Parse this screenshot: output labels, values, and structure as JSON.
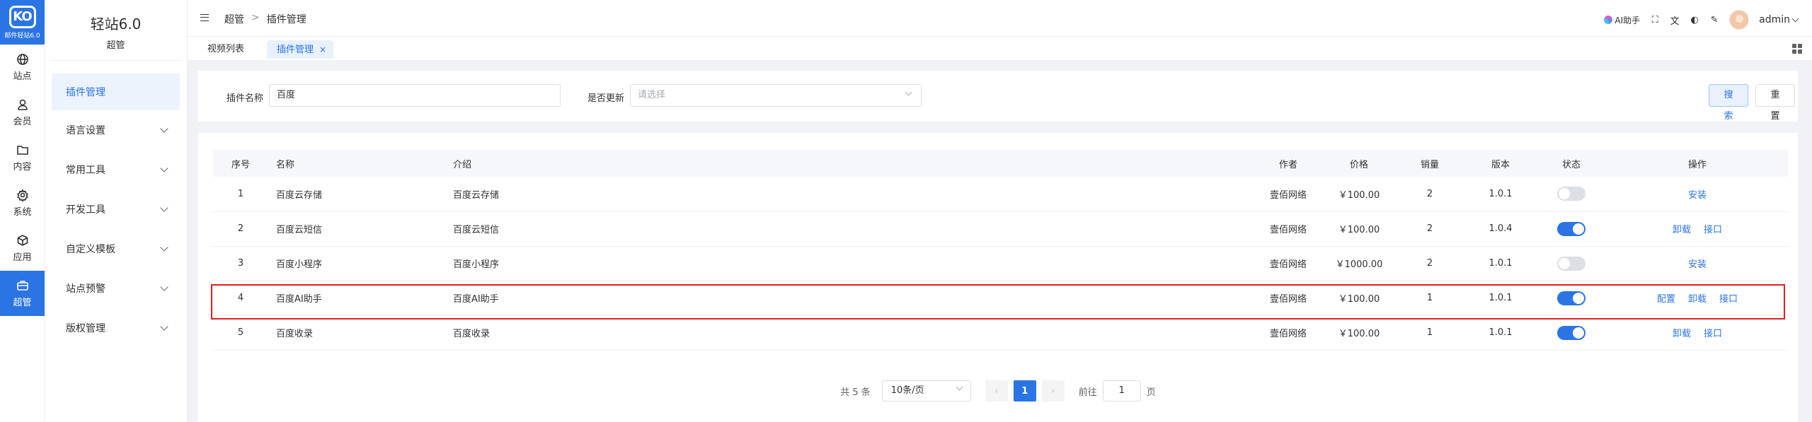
{
  "brand": {
    "logo_text": "KO",
    "logo_sub": "邮件轻站6.0"
  },
  "rail": [
    {
      "key": "site",
      "label": "站点",
      "icon": "globe-icon"
    },
    {
      "key": "member",
      "label": "会员",
      "icon": "user-icon"
    },
    {
      "key": "content",
      "label": "内容",
      "icon": "folder-icon"
    },
    {
      "key": "system",
      "label": "系统",
      "icon": "gear-icon"
    },
    {
      "key": "app",
      "label": "应用",
      "icon": "cube-icon"
    },
    {
      "key": "admin",
      "label": "超管",
      "icon": "briefcase-icon",
      "active": true
    }
  ],
  "sidebar": {
    "title": "轻站6.0",
    "subtitle": "超管",
    "items": [
      {
        "label": "插件管理",
        "active": true
      },
      {
        "label": "语言设置"
      },
      {
        "label": "常用工具"
      },
      {
        "label": "开发工具"
      },
      {
        "label": "自定义模板"
      },
      {
        "label": "站点预警"
      },
      {
        "label": "版权管理"
      }
    ]
  },
  "header": {
    "breadcrumb": [
      "超管",
      ">",
      "插件管理"
    ],
    "ai_label": "AI助手",
    "user": "admin"
  },
  "tabs": [
    {
      "label": "视频列表"
    },
    {
      "label": "插件管理",
      "active": true,
      "close": "×"
    }
  ],
  "search": {
    "name_label": "插件名称",
    "name_value": "百度",
    "update_label": "是否更新",
    "update_placeholder": "请选择",
    "search_button": "搜索",
    "reset_button": "重置"
  },
  "table": {
    "columns": [
      "序号",
      "名称",
      "介绍",
      "作者",
      "价格",
      "销量",
      "版本",
      "状态",
      "操作"
    ],
    "rows": [
      {
        "no": "1",
        "name": "百度云存储",
        "intro": "百度云存储",
        "author": "壹佰网络",
        "price": "￥100.00",
        "sales": "2",
        "version": "1.0.1",
        "enabled": false,
        "actions": [
          "安装"
        ]
      },
      {
        "no": "2",
        "name": "百度云短信",
        "intro": "百度云短信",
        "author": "壹佰网络",
        "price": "￥100.00",
        "sales": "2",
        "version": "1.0.4",
        "enabled": true,
        "actions": [
          "卸载",
          "接口"
        ]
      },
      {
        "no": "3",
        "name": "百度小程序",
        "intro": "百度小程序",
        "author": "壹佰网络",
        "price": "￥1000.00",
        "sales": "2",
        "version": "1.0.1",
        "enabled": false,
        "actions": [
          "安装"
        ]
      },
      {
        "no": "4",
        "name": "百度AI助手",
        "intro": "百度AI助手",
        "author": "壹佰网络",
        "price": "￥100.00",
        "sales": "1",
        "version": "1.0.1",
        "enabled": true,
        "actions": [
          "配置",
          "卸载",
          "接口"
        ]
      },
      {
        "no": "5",
        "name": "百度收录",
        "intro": "百度收录",
        "author": "壹佰网络",
        "price": "￥100.00",
        "sales": "1",
        "version": "1.0.1",
        "enabled": true,
        "actions": [
          "卸载",
          "接口"
        ]
      }
    ]
  },
  "pagination": {
    "total": "共 5 条",
    "page_size": "10条/页",
    "current": "1",
    "goto_label": "前往",
    "goto_value": "1",
    "page_unit": "页"
  },
  "colors": {
    "primary": "#2b74e4",
    "highlight": "#e02020"
  }
}
